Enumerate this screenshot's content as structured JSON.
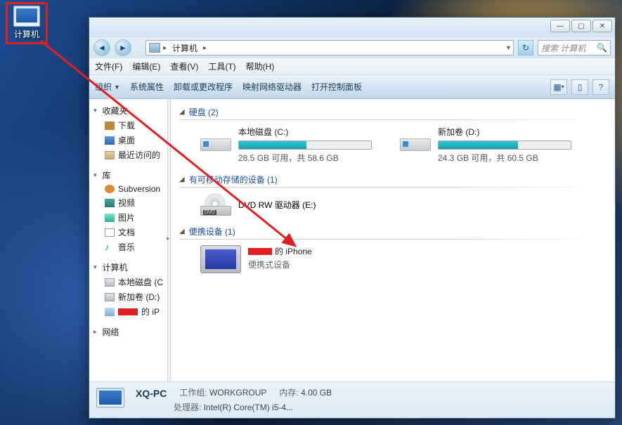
{
  "desktop_icon": {
    "label": "计算机"
  },
  "window": {
    "addr": {
      "crumb": "计算机"
    },
    "search_placeholder": "搜索 计算机",
    "menu": [
      "文件(F)",
      "编辑(E)",
      "查看(V)",
      "工具(T)",
      "帮助(H)"
    ],
    "toolbar": {
      "organize": "组织",
      "items": [
        "系统属性",
        "卸载或更改程序",
        "映射网络驱动器",
        "打开控制面板"
      ]
    },
    "tree": {
      "favorites": {
        "label": "收藏夹",
        "items": [
          "下载",
          "桌面",
          "最近访问的"
        ]
      },
      "libraries": {
        "label": "库",
        "items": [
          "Subversion",
          "视频",
          "图片",
          "文档",
          "音乐"
        ]
      },
      "computer": {
        "label": "计算机",
        "items": [
          "本地磁盘 (C",
          "新加卷 (D:)",
          "的 iP"
        ]
      },
      "network": {
        "label": "网络"
      }
    },
    "sections": {
      "drives": {
        "title": "硬盘 (2)",
        "items": [
          {
            "name": "本地磁盘 (C:)",
            "free": "28.5 GB 可用，共 58.6 GB",
            "pct": 51
          },
          {
            "name": "新加卷 (D:)",
            "free": "24.3 GB 可用，共 60.5 GB",
            "pct": 60
          }
        ]
      },
      "removable": {
        "title": "有可移动存储的设备 (1)",
        "item": "DVD RW 驱动器 (E:)",
        "badge": "DVD"
      },
      "portable": {
        "title": "便携设备 (1)",
        "name_suffix": "的 iPhone",
        "sub": "便携式设备"
      }
    },
    "status": {
      "name": "XQ-PC",
      "workgroup_label": "工作组:",
      "workgroup": "WORKGROUP",
      "memory_label": "内存:",
      "memory": "4.00 GB",
      "cpu_label": "处理器:",
      "cpu": "Intel(R) Core(TM) i5-4..."
    }
  }
}
